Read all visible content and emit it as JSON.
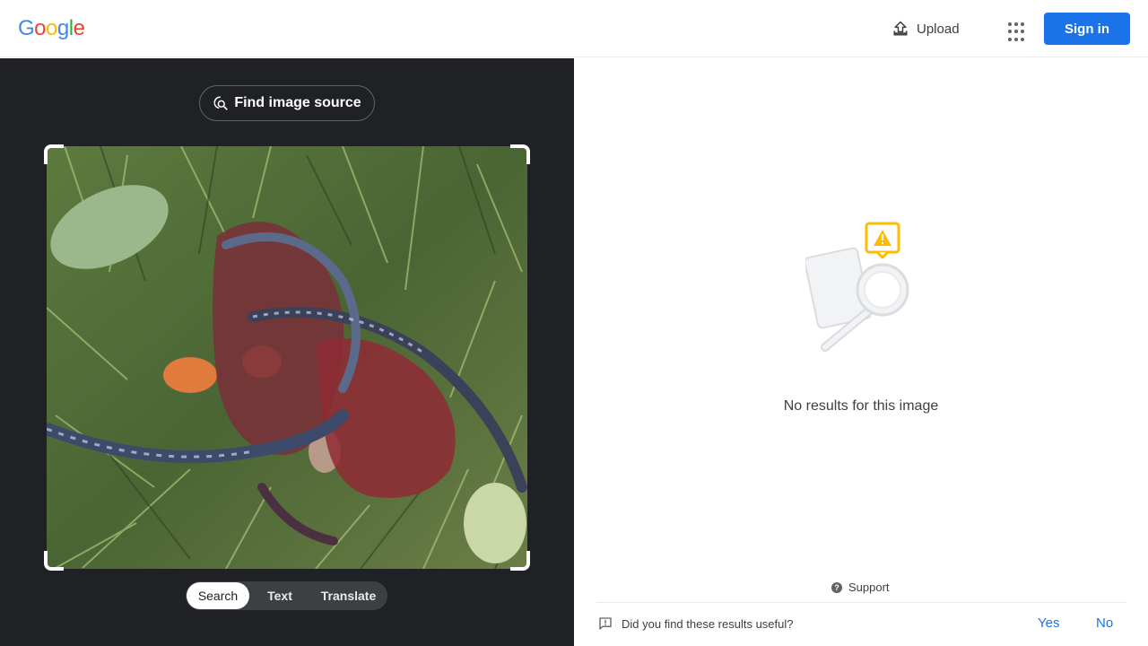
{
  "header": {
    "logo_letters": [
      {
        "char": "G",
        "color": "#4285f4"
      },
      {
        "char": "o",
        "color": "#ea4335"
      },
      {
        "char": "o",
        "color": "#fbbc05"
      },
      {
        "char": "g",
        "color": "#4285f4"
      },
      {
        "char": "l",
        "color": "#34a853"
      },
      {
        "char": "e",
        "color": "#ea4335"
      }
    ],
    "upload_label": "Upload",
    "upload_icon": "upload-icon",
    "apps_icon": "apps-grid-icon",
    "signin_label": "Sign in"
  },
  "left": {
    "find_source_label": "Find image source",
    "find_source_icon": "lens-search-icon",
    "image_description": "",
    "tabs": [
      {
        "label": "Search",
        "active": true
      },
      {
        "label": "Text",
        "active": false
      },
      {
        "label": "Translate",
        "active": false
      }
    ]
  },
  "right": {
    "illustration_icon": "no-results-magnifier-warning-icon",
    "no_results_text": "No results for this image",
    "support_label": "Support",
    "feedback_question": "Did you find these results useful?",
    "feedback_yes": "Yes",
    "feedback_no": "No"
  },
  "colors": {
    "accent": "#1a73e8",
    "dark_panel": "#202124",
    "warning": "#fbbc04"
  }
}
